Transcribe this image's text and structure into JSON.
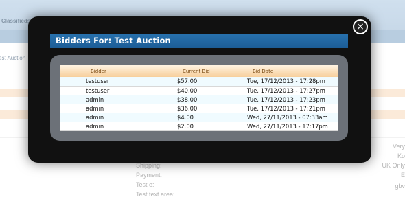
{
  "background": {
    "site_title": "Classifieds",
    "breadcrumb": "est Auction",
    "field_labels": [
      "Shipping:",
      "Payment:",
      "Test e:",
      "Test text area:"
    ],
    "right_values": [
      "Very",
      "Ko",
      "UK Only",
      "E",
      "gbv"
    ]
  },
  "modal": {
    "title": "Bidders For: Test Auction",
    "close_glyph": "×",
    "columns": [
      "Bidder",
      "Current Bid",
      "Bid Date"
    ],
    "rows": [
      {
        "bidder": "testuser",
        "bid": "$57.00",
        "date": "Tue, 17/12/2013 - 17:28pm"
      },
      {
        "bidder": "testuser",
        "bid": "$40.00",
        "date": "Tue, 17/12/2013 - 17:27pm"
      },
      {
        "bidder": "admin",
        "bid": "$38.00",
        "date": "Tue, 17/12/2013 - 17:23pm"
      },
      {
        "bidder": "admin",
        "bid": "$36.00",
        "date": "Tue, 17/12/2013 - 17:21pm"
      },
      {
        "bidder": "admin",
        "bid": "$4.00",
        "date": "Wed, 27/11/2013 - 07:33am"
      },
      {
        "bidder": "admin",
        "bid": "$2.00",
        "date": "Wed, 27/11/2013 - 17:17pm"
      }
    ]
  },
  "colors": {
    "title_bar": "#1c5d96",
    "header_gradient_end": "#f7cf9b",
    "row_stripe": "#f0fbff"
  }
}
